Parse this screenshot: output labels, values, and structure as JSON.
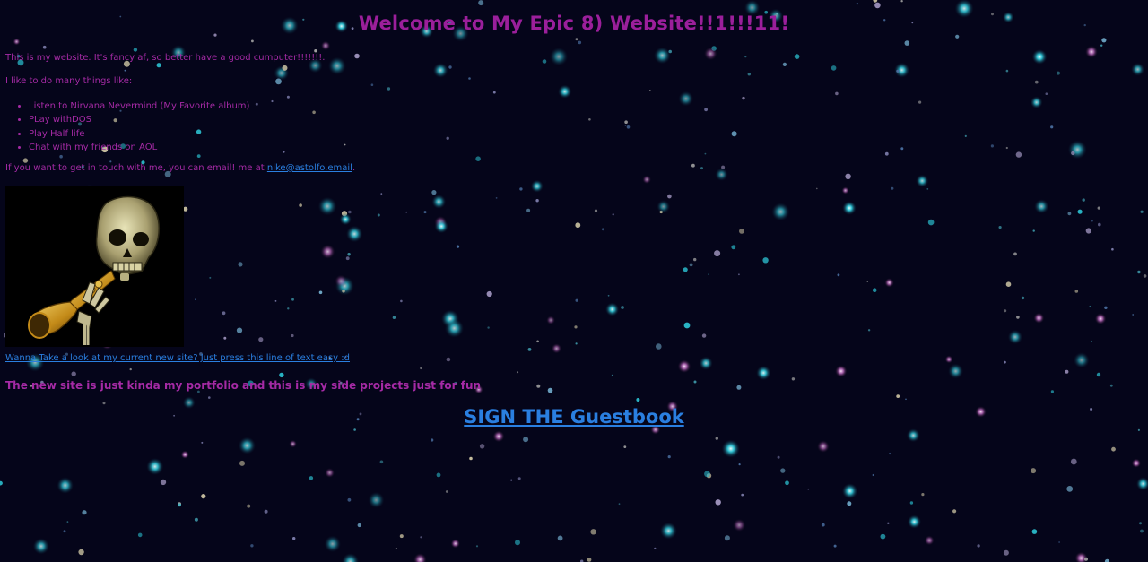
{
  "title": "Welcome to My Epic 8) Website!!1!!!11!",
  "intro": "This is my website. It's fancy af, so better have a good cumputer!!!!!!!.",
  "likes_heading": "I like to do many things like:",
  "likes": [
    "Listen to Nirvana Nevermind (My Favorite album)",
    "PLay withDOS",
    "Play Half life",
    "Chat with my friends on AOL"
  ],
  "contact": {
    "prefix": "If you want to get in touch with me, you can email! me at ",
    "email": "nike@astolfo.email",
    "suffix": "."
  },
  "image": {
    "icon": "skull-trumpet-icon"
  },
  "new_site_link": "Wanna Take a look at my current new site? Just press this line of text easy :d",
  "portfolio_note": "The new site is just kinda my portfolio and this is my side projects just for fun",
  "guestbook_link": "SIGN THE Guestbook",
  "colors": {
    "background": "#05051a",
    "text": "#a52aa5",
    "link": "#2a7fe0"
  }
}
